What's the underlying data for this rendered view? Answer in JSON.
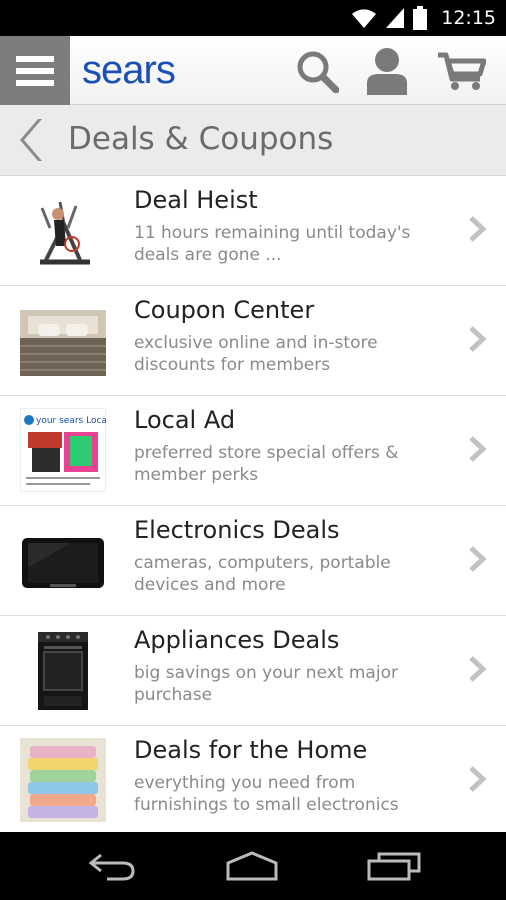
{
  "status_bar": {
    "time": "12:15"
  },
  "header": {
    "logo": "sears"
  },
  "page": {
    "title": "Deals & Coupons"
  },
  "deals": [
    {
      "title": "Deal Heist",
      "description": "11 hours remaining until today's deals are gone ..."
    },
    {
      "title": "Coupon Center",
      "description": "exclusive online and in-store discounts for members"
    },
    {
      "title": "Local Ad",
      "description": "preferred store special offers & member perks",
      "thumb_text": "your sears Local"
    },
    {
      "title": "Electronics Deals",
      "description": "cameras, computers, portable devices and more"
    },
    {
      "title": "Appliances Deals",
      "description": "big savings on your next major purchase"
    },
    {
      "title": "Deals for the Home",
      "description": "everything you need from furnishings to small electronics"
    }
  ],
  "colors": {
    "brand": "#1a4fb5",
    "menu_bg": "#7d7d7d",
    "title_text": "#6b6b6b",
    "desc_text": "#8a8a8a"
  }
}
